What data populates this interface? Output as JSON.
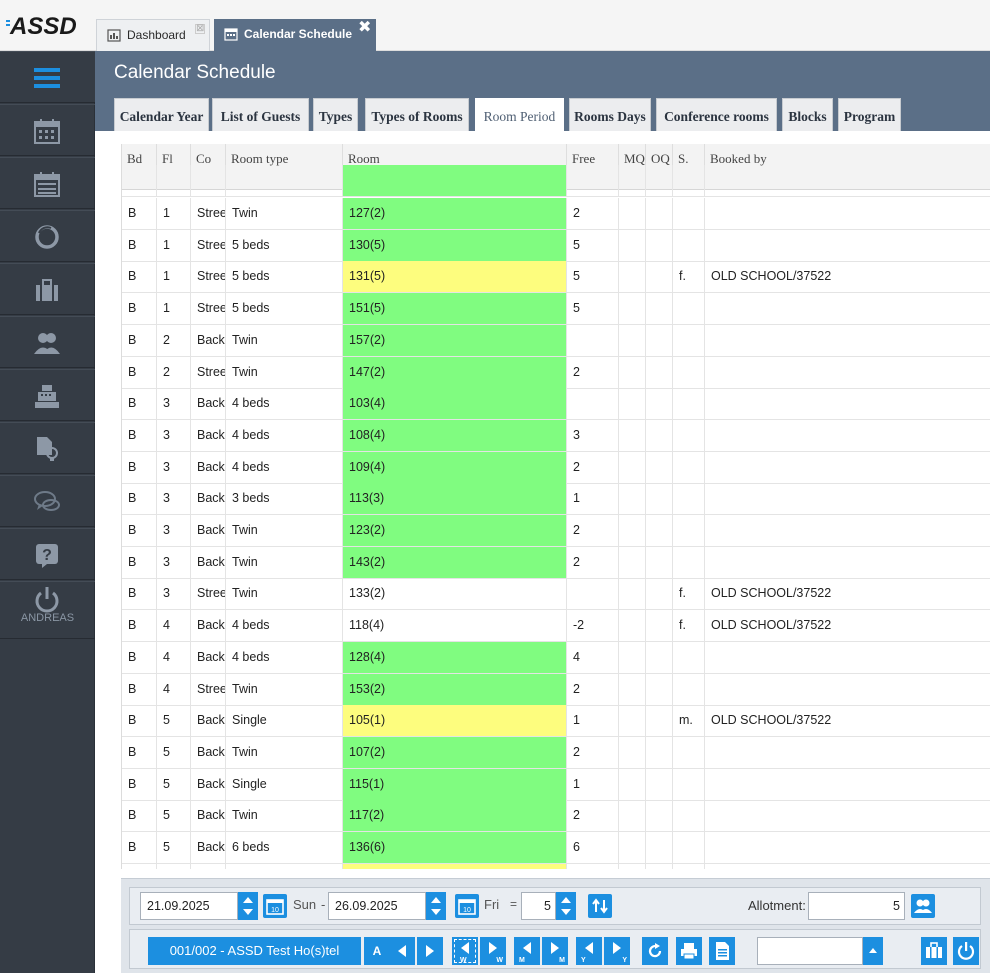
{
  "app": {
    "logo_text": "ASSD"
  },
  "window_tabs": [
    {
      "label": "Dashboard",
      "close": "⊠"
    },
    {
      "label": "Calendar Schedule",
      "close": "✖"
    }
  ],
  "sidebar": {
    "user_label": "ANDREAS",
    "icons": [
      "menu-icon",
      "calendar-icon",
      "calendar-week-icon",
      "ring-icon",
      "briefcase-icon",
      "users-icon",
      "cash-register-icon",
      "document-bulb-icon",
      "chat-icon",
      "help-icon",
      "power-icon"
    ]
  },
  "page": {
    "title": "Calendar Schedule",
    "tabs": [
      "Calendar Year",
      "List of Guests",
      "Types",
      "Types of Rooms",
      "Room Period",
      "Rooms Days",
      "Conference rooms",
      "Blocks",
      "Program"
    ],
    "active_tab": "Room Period"
  },
  "grid": {
    "columns": [
      "Bd",
      "Fl",
      "Co",
      "Room type",
      "Room",
      "Free",
      "MQ",
      "OQ",
      "S.",
      "Booked by"
    ],
    "rows": [
      {
        "bd": "B",
        "fl": "1",
        "co": "Stree",
        "type": "Twin",
        "room": "127(2)",
        "free": "2",
        "mq": "",
        "oq": "",
        "s": "",
        "booked": "",
        "status": "green"
      },
      {
        "bd": "B",
        "fl": "1",
        "co": "Stree",
        "type": "5 beds",
        "room": "130(5)",
        "free": "5",
        "mq": "",
        "oq": "",
        "s": "",
        "booked": "",
        "status": "green"
      },
      {
        "bd": "B",
        "fl": "1",
        "co": "Stree",
        "type": "5 beds",
        "room": "131(5)",
        "free": "5",
        "mq": "",
        "oq": "",
        "s": "f.",
        "booked": "OLD SCHOOL/37522",
        "status": "yellow"
      },
      {
        "bd": "B",
        "fl": "1",
        "co": "Stree",
        "type": "5 beds",
        "room": "151(5)",
        "free": "5",
        "mq": "",
        "oq": "",
        "s": "",
        "booked": "",
        "status": "green"
      },
      {
        "bd": "B",
        "fl": "2",
        "co": "Back",
        "type": "Twin",
        "room": "157(2)",
        "free": "",
        "mq": "",
        "oq": "",
        "s": "",
        "booked": "",
        "status": "green"
      },
      {
        "bd": "B",
        "fl": "2",
        "co": "Stree",
        "type": "Twin",
        "room": "147(2)",
        "free": "2",
        "mq": "",
        "oq": "",
        "s": "",
        "booked": "",
        "status": "green"
      },
      {
        "bd": "B",
        "fl": "3",
        "co": "Back",
        "type": "4 beds",
        "room": "103(4)",
        "free": "",
        "mq": "",
        "oq": "",
        "s": "",
        "booked": "",
        "status": "green"
      },
      {
        "bd": "B",
        "fl": "3",
        "co": "Back",
        "type": "4 beds",
        "room": "108(4)",
        "free": "3",
        "mq": "",
        "oq": "",
        "s": "",
        "booked": "",
        "status": "green"
      },
      {
        "bd": "B",
        "fl": "3",
        "co": "Back",
        "type": "4 beds",
        "room": "109(4)",
        "free": "2",
        "mq": "",
        "oq": "",
        "s": "",
        "booked": "",
        "status": "green"
      },
      {
        "bd": "B",
        "fl": "3",
        "co": "Back",
        "type": "3 beds",
        "room": "113(3)",
        "free": "1",
        "mq": "",
        "oq": "",
        "s": "",
        "booked": "",
        "status": "green"
      },
      {
        "bd": "B",
        "fl": "3",
        "co": "Back",
        "type": "Twin",
        "room": "123(2)",
        "free": "2",
        "mq": "",
        "oq": "",
        "s": "",
        "booked": "",
        "status": "green"
      },
      {
        "bd": "B",
        "fl": "3",
        "co": "Back",
        "type": "Twin",
        "room": "143(2)",
        "free": "2",
        "mq": "",
        "oq": "",
        "s": "",
        "booked": "",
        "status": "green"
      },
      {
        "bd": "B",
        "fl": "3",
        "co": "Stree",
        "type": "Twin",
        "room": "133(2)",
        "free": "",
        "mq": "",
        "oq": "",
        "s": "f.",
        "booked": "OLD SCHOOL/37522",
        "status": "white"
      },
      {
        "bd": "B",
        "fl": "4",
        "co": "Back",
        "type": "4 beds",
        "room": "118(4)",
        "free": "-2",
        "mq": "",
        "oq": "",
        "s": "f.",
        "booked": "OLD SCHOOL/37522",
        "status": "white"
      },
      {
        "bd": "B",
        "fl": "4",
        "co": "Back",
        "type": "4 beds",
        "room": "128(4)",
        "free": "4",
        "mq": "",
        "oq": "",
        "s": "",
        "booked": "",
        "status": "green"
      },
      {
        "bd": "B",
        "fl": "4",
        "co": "Stree",
        "type": "Twin",
        "room": "153(2)",
        "free": "2",
        "mq": "",
        "oq": "",
        "s": "",
        "booked": "",
        "status": "green"
      },
      {
        "bd": "B",
        "fl": "5",
        "co": "Back",
        "type": "Single",
        "room": "105(1)",
        "free": "1",
        "mq": "",
        "oq": "",
        "s": "m.",
        "booked": "OLD SCHOOL/37522",
        "status": "yellow"
      },
      {
        "bd": "B",
        "fl": "5",
        "co": "Back",
        "type": "Twin",
        "room": "107(2)",
        "free": "2",
        "mq": "",
        "oq": "",
        "s": "",
        "booked": "",
        "status": "green"
      },
      {
        "bd": "B",
        "fl": "5",
        "co": "Back",
        "type": "Single",
        "room": "115(1)",
        "free": "1",
        "mq": "",
        "oq": "",
        "s": "",
        "booked": "",
        "status": "green"
      },
      {
        "bd": "B",
        "fl": "5",
        "co": "Back",
        "type": "Twin",
        "room": "117(2)",
        "free": "2",
        "mq": "",
        "oq": "",
        "s": "",
        "booked": "",
        "status": "green"
      },
      {
        "bd": "B",
        "fl": "5",
        "co": "Back",
        "type": "6 beds",
        "room": "136(6)",
        "free": "6",
        "mq": "",
        "oq": "",
        "s": "",
        "booked": "",
        "status": "green"
      }
    ]
  },
  "toolbar": {
    "date_from": "21.09.2025",
    "day_from": "Sun",
    "dash": "-",
    "date_to": "26.09.2025",
    "day_to": "Fri",
    "equals": "=",
    "days_count": "5",
    "allotment_label": "Allotment:",
    "allotment_value": "5",
    "hotel_button": "001/002 - ASSD Test Ho(s)tel",
    "a_button": "A",
    "nav_labels": {
      "week": "W",
      "month": "M",
      "year": "Y"
    },
    "select_value": ""
  },
  "colors": {
    "header_bg": "#5b6f87",
    "sidebar_bg": "#353c45",
    "accent_blue": "#1c8fe0",
    "free_green": "#80fc80",
    "booked_yellow": "#fdfd7e"
  }
}
